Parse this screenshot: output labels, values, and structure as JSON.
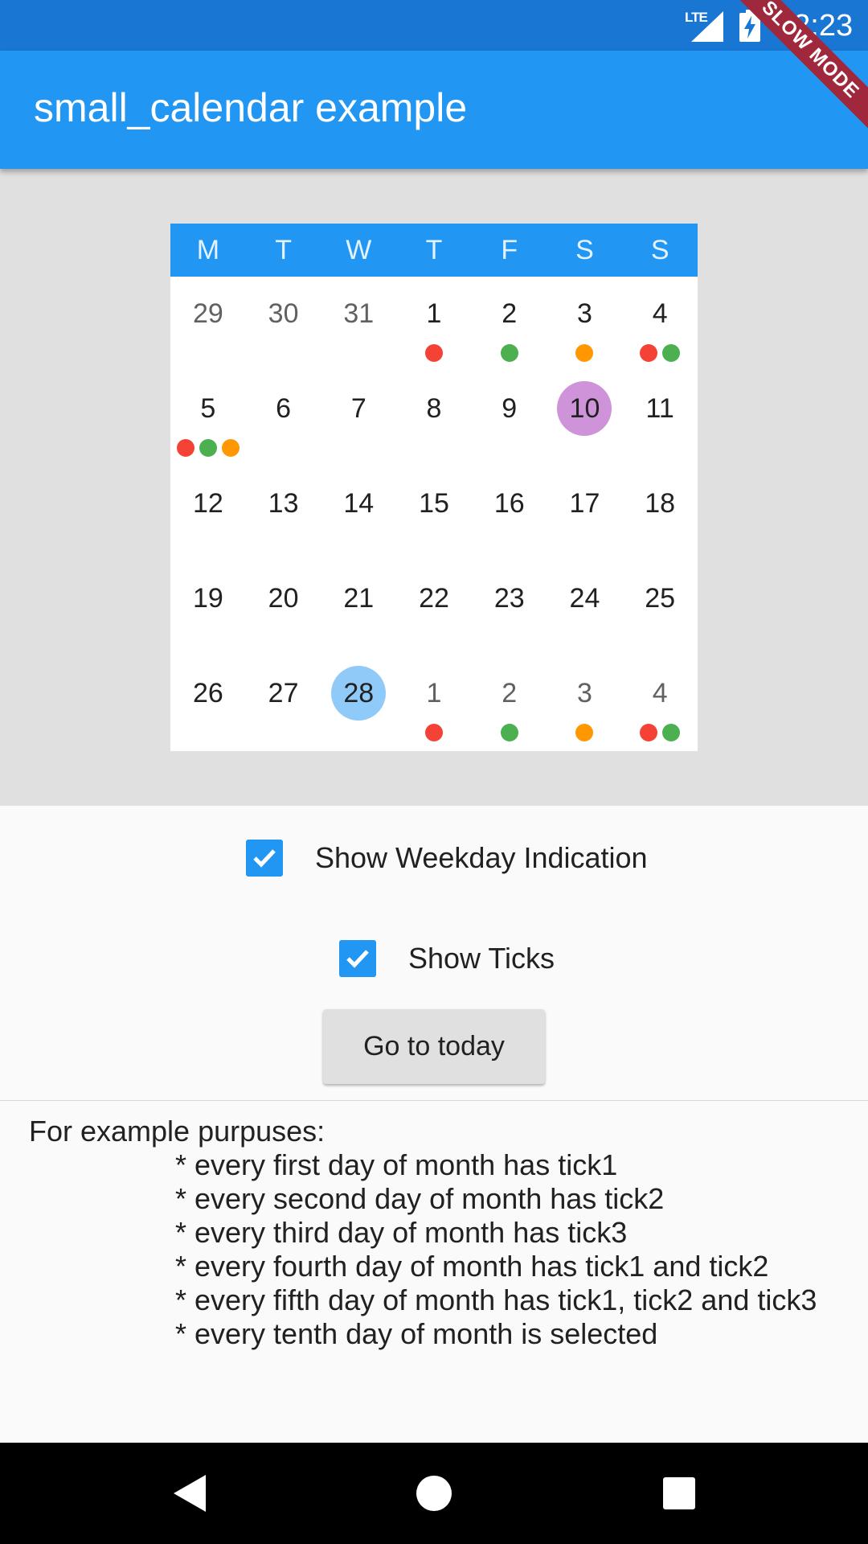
{
  "status_bar": {
    "network": "LTE",
    "time": "12:23"
  },
  "app_bar": {
    "title": "small_calendar example"
  },
  "debug_banner": {
    "label": "SLOW MODE"
  },
  "calendar": {
    "weekdays": [
      "M",
      "T",
      "W",
      "T",
      "F",
      "S",
      "S"
    ],
    "weeks": [
      [
        {
          "d": "29",
          "other": true
        },
        {
          "d": "30",
          "other": true
        },
        {
          "d": "31",
          "other": true
        },
        {
          "d": "1",
          "ticks": [
            "t1"
          ]
        },
        {
          "d": "2",
          "ticks": [
            "t2"
          ]
        },
        {
          "d": "3",
          "ticks": [
            "t3"
          ]
        },
        {
          "d": "4",
          "ticks": [
            "t1",
            "t2"
          ]
        }
      ],
      [
        {
          "d": "5",
          "ticks": [
            "t1",
            "t2",
            "t3"
          ]
        },
        {
          "d": "6"
        },
        {
          "d": "7"
        },
        {
          "d": "8"
        },
        {
          "d": "9"
        },
        {
          "d": "10",
          "selected": true
        },
        {
          "d": "11"
        }
      ],
      [
        {
          "d": "12"
        },
        {
          "d": "13"
        },
        {
          "d": "14"
        },
        {
          "d": "15"
        },
        {
          "d": "16"
        },
        {
          "d": "17"
        },
        {
          "d": "18"
        }
      ],
      [
        {
          "d": "19"
        },
        {
          "d": "20"
        },
        {
          "d": "21"
        },
        {
          "d": "22"
        },
        {
          "d": "23"
        },
        {
          "d": "24"
        },
        {
          "d": "25"
        }
      ],
      [
        {
          "d": "26"
        },
        {
          "d": "27"
        },
        {
          "d": "28",
          "today": true
        },
        {
          "d": "1",
          "other": true,
          "ticks": [
            "t1"
          ]
        },
        {
          "d": "2",
          "other": true,
          "ticks": [
            "t2"
          ]
        },
        {
          "d": "3",
          "other": true,
          "ticks": [
            "t3"
          ]
        },
        {
          "d": "4",
          "other": true,
          "ticks": [
            "t1",
            "t2"
          ]
        }
      ]
    ],
    "colors": {
      "header": "#2196f3",
      "selected": "#ce93d8",
      "today": "#90caf9",
      "tick1": "#f44336",
      "tick2": "#4caf50",
      "tick3": "#ff9800"
    }
  },
  "controls": {
    "weekday_indication": {
      "label": "Show Weekday Indication",
      "checked": true
    },
    "ticks": {
      "label": "Show Ticks",
      "checked": true
    },
    "today_button": "Go to today"
  },
  "description": {
    "intro": "For example purpuses:",
    "lines": [
      "* every first day of month has tick1",
      "* every second day of month has tick2",
      "* every third day of month has tick3",
      "* every fourth day of month has tick1 and tick2",
      "* every fifth day of month has tick1, tick2 and tick3",
      "* every tenth day of month is selected"
    ]
  },
  "nav_bar": {
    "icons": [
      "back-icon",
      "home-icon",
      "recents-icon"
    ]
  }
}
